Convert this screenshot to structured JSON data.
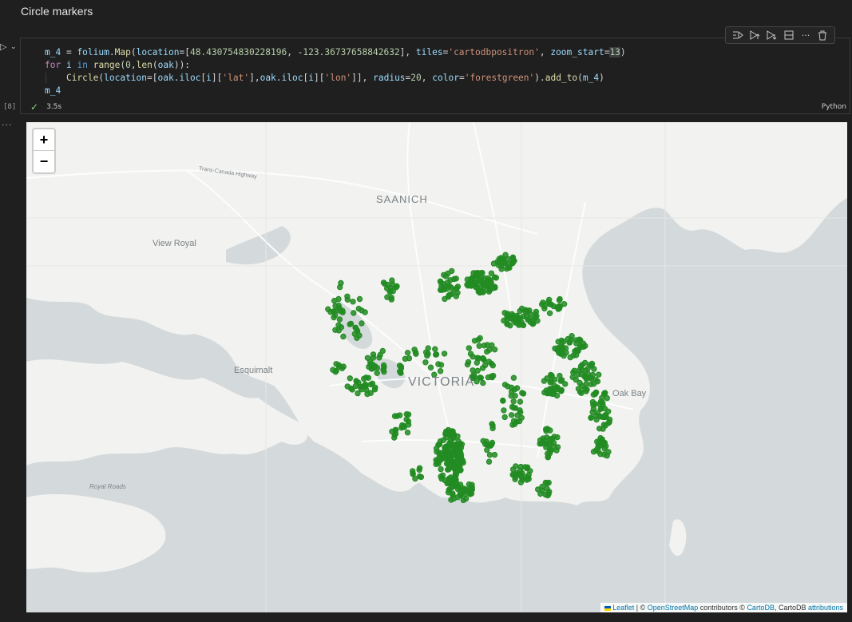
{
  "heading": "Circle markers",
  "cell": {
    "execution_count": "[8]",
    "status_time": "3.5s",
    "language": "Python",
    "code_lines": [
      [
        {
          "t": "m_4",
          "c": "tk-var"
        },
        {
          "t": " = ",
          "c": "tk-op"
        },
        {
          "t": "folium",
          "c": "tk-var"
        },
        {
          "t": ".",
          "c": "tk-op"
        },
        {
          "t": "Map",
          "c": "tk-fn"
        },
        {
          "t": "(",
          "c": "tk-op"
        },
        {
          "t": "location",
          "c": "tk-var"
        },
        {
          "t": "=[",
          "c": "tk-op"
        },
        {
          "t": "48.430754830228196",
          "c": "tk-num"
        },
        {
          "t": ", -",
          "c": "tk-op"
        },
        {
          "t": "123.36737658842632",
          "c": "tk-num"
        },
        {
          "t": "], ",
          "c": "tk-op"
        },
        {
          "t": "tiles",
          "c": "tk-var"
        },
        {
          "t": "=",
          "c": "tk-op"
        },
        {
          "t": "'cartodbpositron'",
          "c": "tk-str"
        },
        {
          "t": ", ",
          "c": "tk-op"
        },
        {
          "t": "zoom_start",
          "c": "tk-var"
        },
        {
          "t": "=",
          "c": "tk-op"
        },
        {
          "t": "13",
          "c": "tk-num tk-hl"
        },
        {
          "t": ")",
          "c": "tk-op"
        }
      ],
      [
        {
          "t": "for",
          "c": "tk-kw"
        },
        {
          "t": " ",
          "c": "tk-op"
        },
        {
          "t": "i",
          "c": "tk-var"
        },
        {
          "t": " ",
          "c": "tk-op"
        },
        {
          "t": "in",
          "c": "tk-kw2"
        },
        {
          "t": " ",
          "c": "tk-op"
        },
        {
          "t": "range",
          "c": "tk-fn"
        },
        {
          "t": "(",
          "c": "tk-op"
        },
        {
          "t": "0",
          "c": "tk-num"
        },
        {
          "t": ",",
          "c": "tk-op"
        },
        {
          "t": "len",
          "c": "tk-fn"
        },
        {
          "t": "(",
          "c": "tk-op"
        },
        {
          "t": "oak",
          "c": "tk-var"
        },
        {
          "t": ")):",
          "c": "tk-op"
        }
      ],
      [
        {
          "t": "    ",
          "c": "ind"
        },
        {
          "t": "Circle",
          "c": "tk-fn"
        },
        {
          "t": "(",
          "c": "tk-op"
        },
        {
          "t": "location",
          "c": "tk-var"
        },
        {
          "t": "=[",
          "c": "tk-op"
        },
        {
          "t": "oak",
          "c": "tk-var"
        },
        {
          "t": ".",
          "c": "tk-op"
        },
        {
          "t": "iloc",
          "c": "tk-var"
        },
        {
          "t": "[",
          "c": "tk-op"
        },
        {
          "t": "i",
          "c": "tk-var"
        },
        {
          "t": "][",
          "c": "tk-op"
        },
        {
          "t": "'lat'",
          "c": "tk-str"
        },
        {
          "t": "],",
          "c": "tk-op"
        },
        {
          "t": "oak",
          "c": "tk-var"
        },
        {
          "t": ".",
          "c": "tk-op"
        },
        {
          "t": "iloc",
          "c": "tk-var"
        },
        {
          "t": "[",
          "c": "tk-op"
        },
        {
          "t": "i",
          "c": "tk-var"
        },
        {
          "t": "][",
          "c": "tk-op"
        },
        {
          "t": "'lon'",
          "c": "tk-str"
        },
        {
          "t": "]], ",
          "c": "tk-op"
        },
        {
          "t": "radius",
          "c": "tk-var"
        },
        {
          "t": "=",
          "c": "tk-op"
        },
        {
          "t": "20",
          "c": "tk-num"
        },
        {
          "t": ", ",
          "c": "tk-op"
        },
        {
          "t": "color",
          "c": "tk-var"
        },
        {
          "t": "=",
          "c": "tk-op"
        },
        {
          "t": "'forestgreen'",
          "c": "tk-str"
        },
        {
          "t": ").",
          "c": "tk-op"
        },
        {
          "t": "add_to",
          "c": "tk-fn"
        },
        {
          "t": "(",
          "c": "tk-op"
        },
        {
          "t": "m_4",
          "c": "tk-var"
        },
        {
          "t": ")",
          "c": "tk-op"
        }
      ],
      [
        {
          "t": "m_4",
          "c": "tk-var"
        }
      ]
    ]
  },
  "toolbar": {
    "icons": [
      "run-by-line-icon",
      "execute-above-icon",
      "execute-below-icon",
      "split-cell-icon",
      "more-icon",
      "delete-icon"
    ]
  },
  "map": {
    "zoom_in": "+",
    "zoom_out": "−",
    "marker_color": "#228b22",
    "water_color": "#d4dadc",
    "land_color": "#f2f2f0",
    "places": {
      "saanich": "SAANICH",
      "view_royal": "View Royal",
      "esquimalt": "Esquimalt",
      "victoria": "VICTORIA",
      "oak_bay": "Oak Bay",
      "royal_roads": "Royal Roads",
      "highway": "Trans-Canada Highway"
    },
    "attribution": {
      "leaflet": "Leaflet",
      "sep1": " | © ",
      "osm": "OpenStreetMap",
      "mid": " contributors © ",
      "carto": "CartoDB",
      "mid2": ", CartoDB ",
      "attr": "attributions"
    }
  }
}
